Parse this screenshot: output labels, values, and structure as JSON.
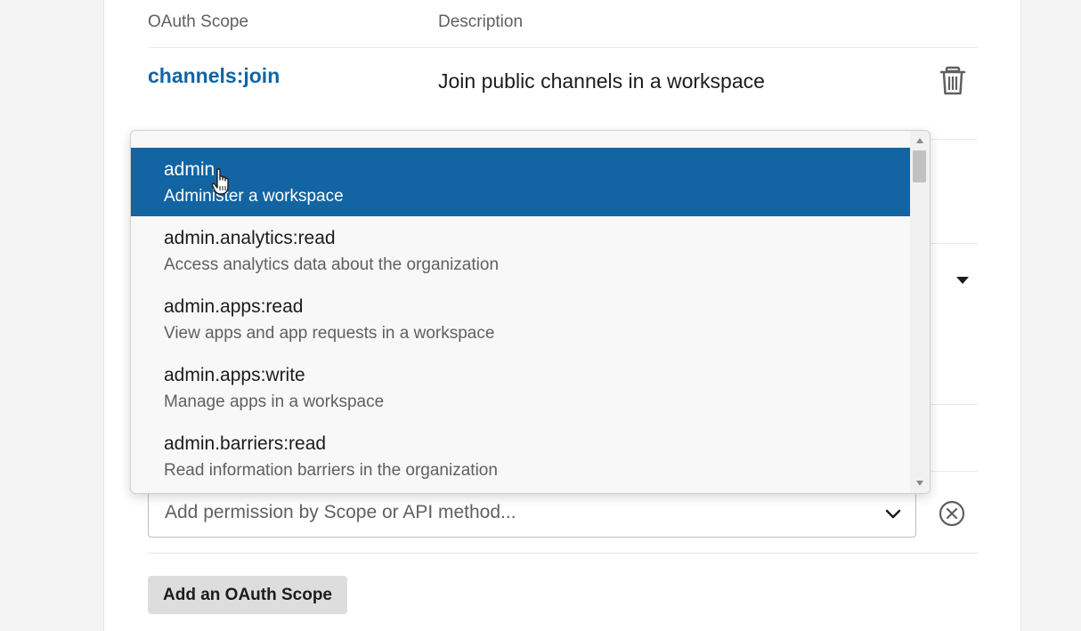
{
  "table": {
    "header_scope": "OAuth Scope",
    "header_description": "Description",
    "rows": [
      {
        "scope": "channels:join",
        "description": "Join public channels in a workspace"
      }
    ]
  },
  "dropdown": {
    "options": [
      {
        "name": "admin",
        "description": "Administer a workspace",
        "highlighted": true
      },
      {
        "name": "admin.analytics:read",
        "description": "Access analytics data about the organization"
      },
      {
        "name": "admin.apps:read",
        "description": "View apps and app requests in a workspace"
      },
      {
        "name": "admin.apps:write",
        "description": "Manage apps in a workspace"
      },
      {
        "name": "admin.barriers:read",
        "description": "Read information barriers in the organization"
      }
    ]
  },
  "select": {
    "placeholder": "Add permission by Scope or API method..."
  },
  "buttons": {
    "add_scope": "Add an OAuth Scope"
  },
  "colors": {
    "link": "#1264a3",
    "highlight": "#1264a3"
  }
}
